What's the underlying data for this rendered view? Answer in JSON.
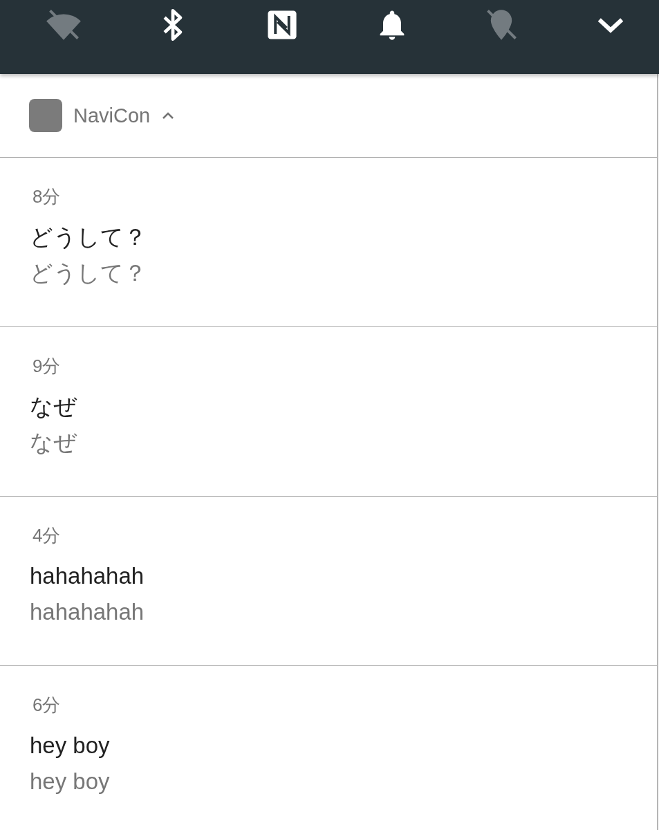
{
  "quick_settings": [
    {
      "kind": "wifi",
      "on": false
    },
    {
      "kind": "bluetooth",
      "on": true
    },
    {
      "kind": "nfc",
      "on": true
    },
    {
      "kind": "bell",
      "on": true
    },
    {
      "kind": "location",
      "on": false
    }
  ],
  "app": {
    "name": "NaviCon",
    "expanded": true
  },
  "notifications": [
    {
      "time": "8分",
      "title": "どうして？",
      "text": "どうして？"
    },
    {
      "time": "9分",
      "title": "なぜ",
      "text": "なぜ"
    },
    {
      "time": "4分",
      "title": "hahahahah",
      "text": "hahahahah"
    },
    {
      "time": "6分",
      "title": "hey boy",
      "text": "hey boy"
    }
  ]
}
